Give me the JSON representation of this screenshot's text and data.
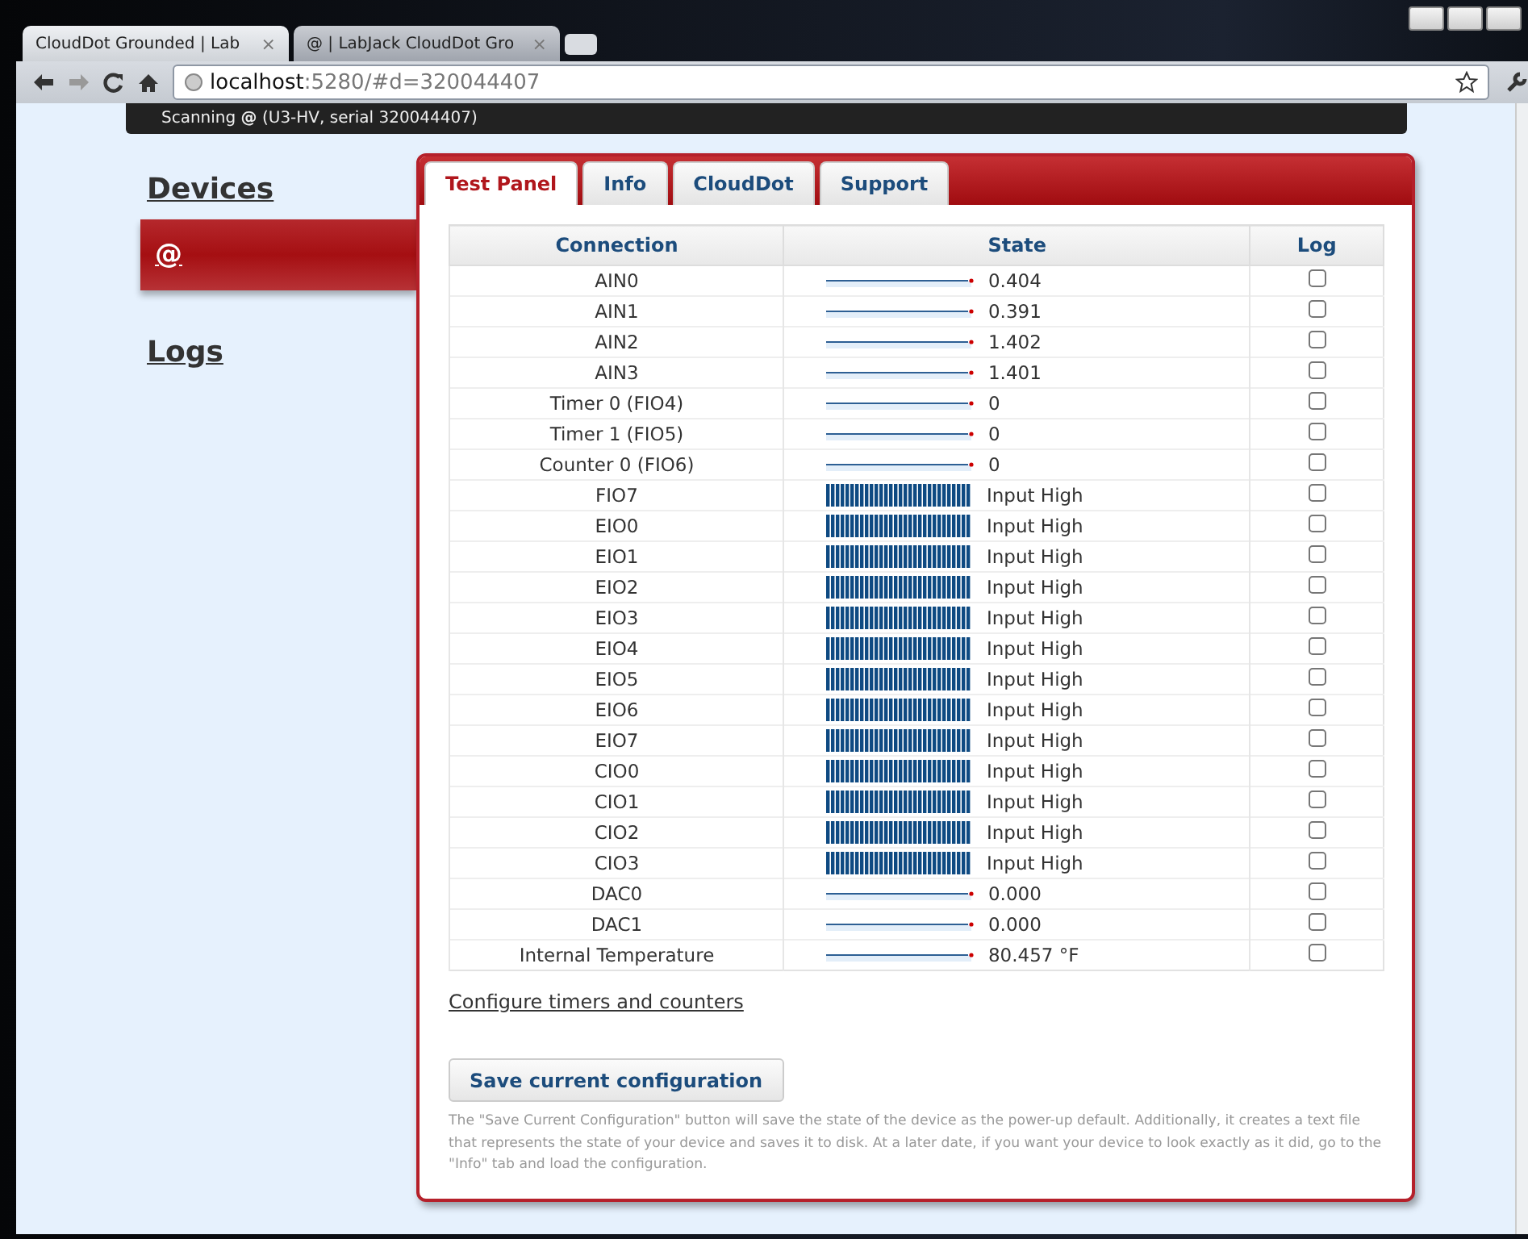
{
  "browser": {
    "tabs": [
      {
        "title": "CloudDot Grounded | Lab",
        "selected": false,
        "close": "×"
      },
      {
        "title": "@ | LabJack CloudDot Gro",
        "selected": true,
        "close": "×"
      }
    ],
    "address": {
      "host": "localhost",
      "rest": ":5280/#d=320044407"
    }
  },
  "status_bar": "Scanning **@** (U3-HV, serial 320044407)",
  "sidebar": {
    "items": [
      {
        "label": "Devices",
        "kind": "heading",
        "selected": false
      },
      {
        "label": "@",
        "kind": "device",
        "selected": true
      },
      {
        "label": "Logs",
        "kind": "heading",
        "selected": false
      }
    ]
  },
  "tabs": [
    {
      "label": "Test Panel",
      "selected": true
    },
    {
      "label": "Info",
      "selected": false
    },
    {
      "label": "CloudDot",
      "selected": false
    },
    {
      "label": "Support",
      "selected": false
    }
  ],
  "table": {
    "columns": [
      "Connection",
      "State",
      "Log"
    ],
    "rows": [
      {
        "name": "AIN0",
        "kind": "analog",
        "value": "0.404",
        "log": false
      },
      {
        "name": "AIN1",
        "kind": "analog",
        "value": "0.391",
        "log": false
      },
      {
        "name": "AIN2",
        "kind": "analog",
        "value": "1.402",
        "log": false
      },
      {
        "name": "AIN3",
        "kind": "analog",
        "value": "1.401",
        "log": false
      },
      {
        "name": "Timer 0 (FIO4)",
        "kind": "analog",
        "value": "0",
        "log": false
      },
      {
        "name": "Timer 1 (FIO5)",
        "kind": "analog",
        "value": "0",
        "log": false
      },
      {
        "name": "Counter 0 (FIO6)",
        "kind": "analog",
        "value": "0",
        "log": false
      },
      {
        "name": "FIO7",
        "kind": "digital",
        "value": "Input High",
        "log": false
      },
      {
        "name": "EIO0",
        "kind": "digital",
        "value": "Input High",
        "log": false
      },
      {
        "name": "EIO1",
        "kind": "digital",
        "value": "Input High",
        "log": false
      },
      {
        "name": "EIO2",
        "kind": "digital",
        "value": "Input High",
        "log": false
      },
      {
        "name": "EIO3",
        "kind": "digital",
        "value": "Input High",
        "log": false
      },
      {
        "name": "EIO4",
        "kind": "digital",
        "value": "Input High",
        "log": false
      },
      {
        "name": "EIO5",
        "kind": "digital",
        "value": "Input High",
        "log": false
      },
      {
        "name": "EIO6",
        "kind": "digital",
        "value": "Input High",
        "log": false
      },
      {
        "name": "EIO7",
        "kind": "digital",
        "value": "Input High",
        "log": false
      },
      {
        "name": "CIO0",
        "kind": "digital",
        "value": "Input High",
        "log": false
      },
      {
        "name": "CIO1",
        "kind": "digital",
        "value": "Input High",
        "log": false
      },
      {
        "name": "CIO2",
        "kind": "digital",
        "value": "Input High",
        "log": false
      },
      {
        "name": "CIO3",
        "kind": "digital",
        "value": "Input High",
        "log": false
      },
      {
        "name": "DAC0",
        "kind": "analog",
        "value": "0.000",
        "log": false
      },
      {
        "name": "DAC1",
        "kind": "analog",
        "value": "0.000",
        "log": false
      },
      {
        "name": "Internal Temperature",
        "kind": "analog",
        "value": "80.457 °F",
        "log": false
      }
    ]
  },
  "configure_link": "Configure timers and counters",
  "save_button": "Save current configuration",
  "help_text": "The \"Save Current Configuration\" button will save the state of the device as the power-up default. Additionally, it creates a text file that represents the state of your device and saves it to disk. At a later date, if you want your device to look exactly as it did, go to the \"Info\" tab and load the configuration."
}
